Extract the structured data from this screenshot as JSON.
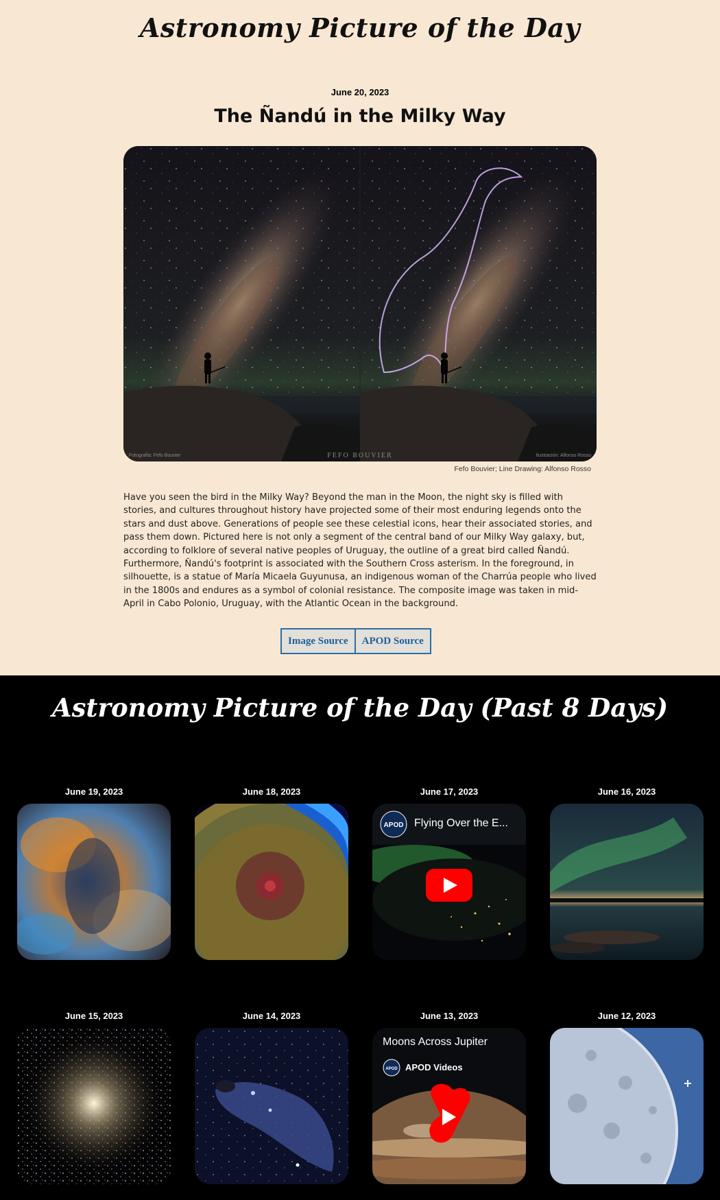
{
  "header": {
    "title": "Astronomy Picture of the Day"
  },
  "featured": {
    "date": "June 20, 2023",
    "title": "The Ñandú in the Milky Way",
    "credit": "Fefo Bouvier; Line Drawing: Alfonso Rosso",
    "image_overlay_left": "Fotografía: Fefo Bouvier",
    "image_overlay_center": "FEFO BOUVIER",
    "image_overlay_right": "Ilustración: Alfonso Rosso",
    "explanation": "Have you seen the bird in the Milky Way? Beyond the man in the Moon, the night sky is filled with stories, and cultures throughout history have projected some of their most enduring legends onto the stars and dust above. Generations of people see these celestial icons, hear their associated stories, and pass them down. Pictured here is not only a segment of the central band of our Milky Way galaxy, but, according to folklore of several native peoples of Uruguay, the outline of a great bird called Ñandú. Furthermore, Ñandú's footprint is associated with the Southern Cross asterism. In the foreground, in silhouette, is a statue of María Micaela Guyunusa, an indigenous woman of the Charrúa people who lived in the 1800s and endures as a symbol of colonial resistance. The composite image was taken in mid-April in Cabo Polonio, Uruguay, with the Atlantic Ocean in the background.",
    "image_source_label": "Image Source",
    "apod_source_label": "APOD Source"
  },
  "past": {
    "title": "Astronomy Picture of the Day (Past 8 Days)",
    "items": [
      {
        "date": "June 19, 2023",
        "kind": "image"
      },
      {
        "date": "June 18, 2023",
        "kind": "image"
      },
      {
        "date": "June 17, 2023",
        "kind": "video",
        "video_title": "Flying Over the E...",
        "channel_logo": "APOD"
      },
      {
        "date": "June 16, 2023",
        "kind": "image"
      },
      {
        "date": "June 15, 2023",
        "kind": "image"
      },
      {
        "date": "June 14, 2023",
        "kind": "image"
      },
      {
        "date": "June 13, 2023",
        "kind": "video",
        "video_title": "Moons Across Jupiter",
        "channel_name": "APOD Videos",
        "channel_logo": "APOD"
      },
      {
        "date": "June 12, 2023",
        "kind": "image"
      }
    ]
  },
  "colors": {
    "page_bg": "#f8e8d3",
    "past_bg": "#000000",
    "link_border": "#2b6ea6",
    "link_text": "#1f5f99",
    "youtube_red": "#ff0000"
  }
}
